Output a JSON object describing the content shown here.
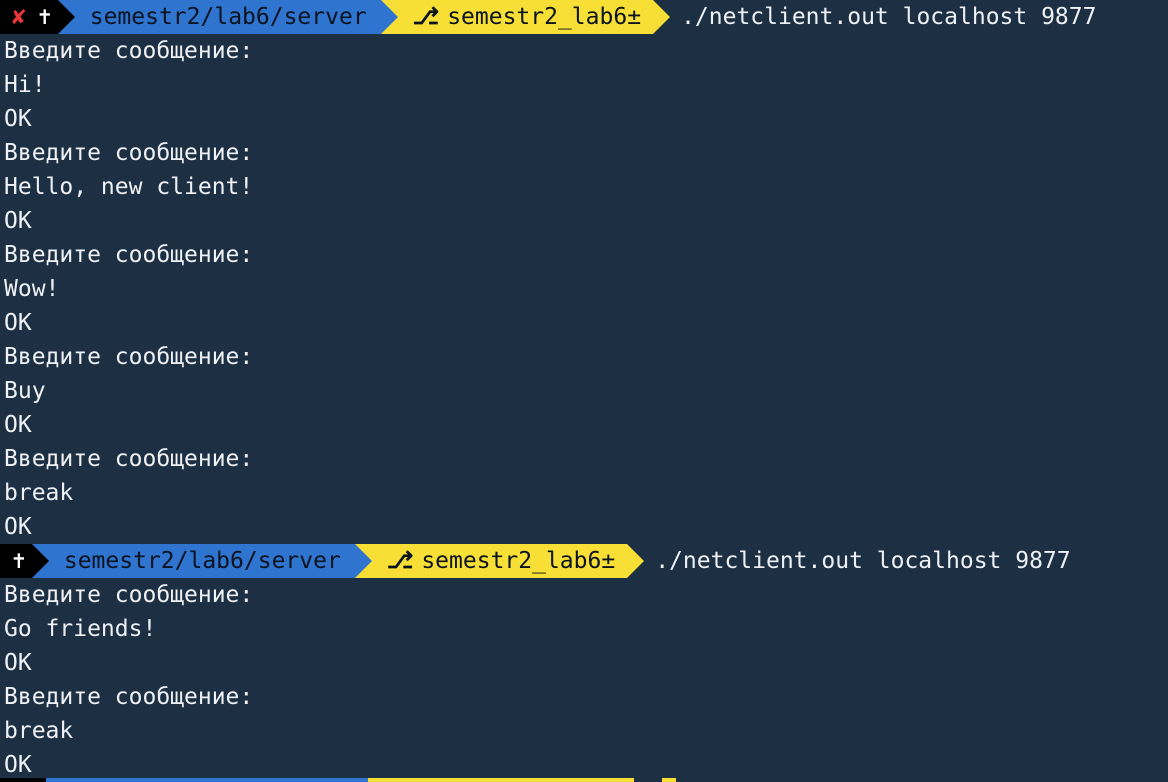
{
  "prompts": [
    {
      "show_error": true,
      "error_symbol": "✘",
      "root_symbol": "✝",
      "path": "semestr2/lab6/server",
      "branch_symbol": "⎇",
      "branch": "semestr2_lab6±",
      "command": "./netclient.out localhost 9877"
    },
    {
      "show_error": false,
      "root_symbol": "✝",
      "path": "semestr2/lab6/server",
      "branch_symbol": "⎇",
      "branch": "semestr2_lab6±",
      "command": "./netclient.out localhost 9877"
    }
  ],
  "output": {
    "session1": [
      "Введите сообщение:",
      "Hi!",
      "OK",
      "Введите сообщение:",
      "Hello, new client!",
      "OK",
      "Введите сообщение:",
      "Wow!",
      "OK",
      "Введите сообщение:",
      "Buy",
      "OK",
      "Введите сообщение:",
      "break",
      "OK"
    ],
    "session2": [
      "Введите сообщение:",
      "Go friends!",
      "OK",
      "Введите сообщение:",
      "break",
      "OK"
    ]
  },
  "colors": {
    "background": "#1d2f42",
    "path_segment": "#2f74cf",
    "branch_segment": "#f7df35",
    "error": "#e8353a"
  }
}
